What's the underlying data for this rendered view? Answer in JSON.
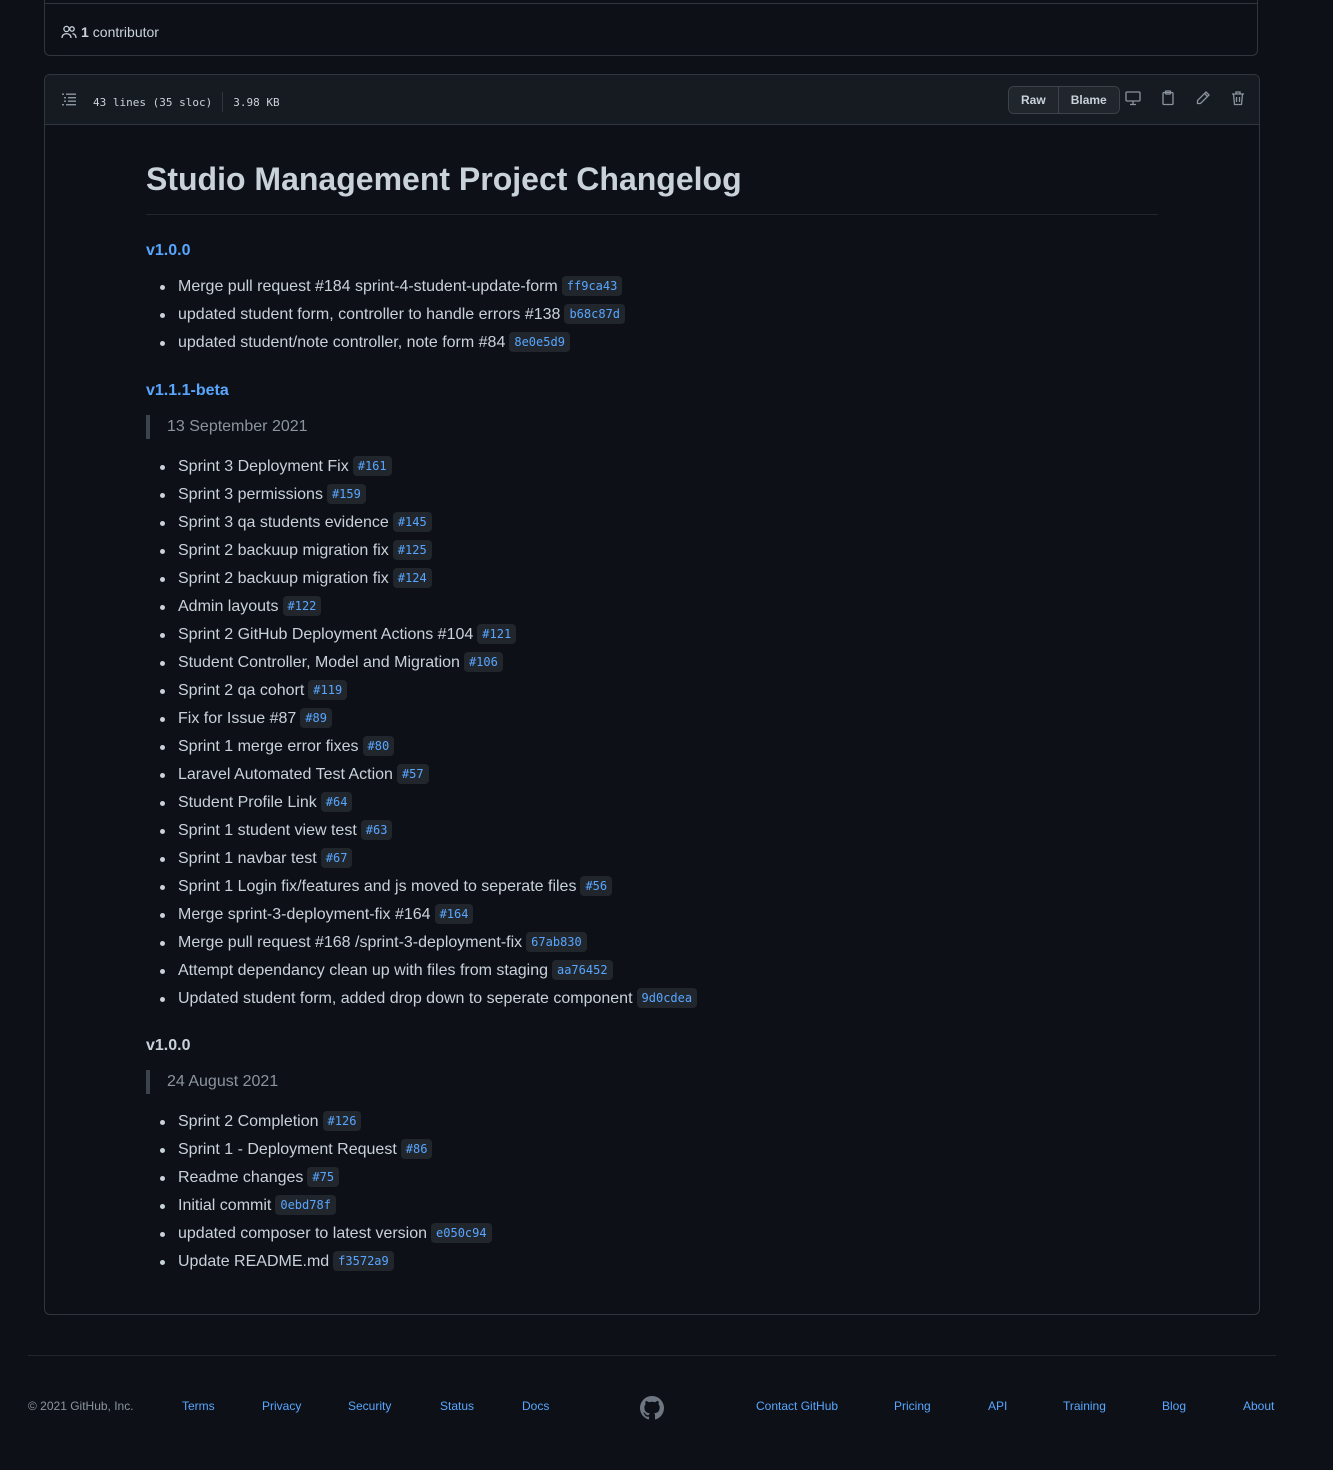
{
  "contributors": {
    "count": "1",
    "label": "contributor"
  },
  "file_header": {
    "lines": "43 lines (35 sloc)",
    "size": "3.98 KB",
    "raw_label": "Raw",
    "blame_label": "Blame"
  },
  "icons": [
    "toc-icon",
    "desktop-icon",
    "clipboard-icon",
    "pencil-icon",
    "trash-icon",
    "people-icon",
    "github-mark-icon"
  ],
  "markdown": {
    "title": "Studio Management Project Changelog",
    "section1": {
      "heading": "v1.0.0",
      "items": [
        {
          "text": "Merge pull request #184 sprint-4-student-update-form",
          "code": "ff9ca43"
        },
        {
          "text": "updated student form, controller to handle errors #138",
          "code": "b68c87d"
        },
        {
          "text": "updated student/note controller, note form #84",
          "code": "8e0e5d9"
        }
      ]
    },
    "section2": {
      "heading": "v1.1.1-beta",
      "date": "13 September 2021",
      "items": [
        {
          "text": "Sprint 3 Deployment Fix",
          "code": "#161"
        },
        {
          "text": "Sprint 3 permissions",
          "code": "#159"
        },
        {
          "text": "Sprint 3 qa students evidence",
          "code": "#145"
        },
        {
          "text": "Sprint 2 backuup migration fix",
          "code": "#125"
        },
        {
          "text": "Sprint 2 backuup migration fix",
          "code": "#124"
        },
        {
          "text": "Admin layouts",
          "code": "#122"
        },
        {
          "text": "Sprint 2 GitHub Deployment Actions #104",
          "code": "#121"
        },
        {
          "text": "Student Controller, Model and Migration",
          "code": "#106"
        },
        {
          "text": "Sprint 2 qa cohort",
          "code": "#119"
        },
        {
          "text": "Fix for Issue #87",
          "code": "#89"
        },
        {
          "text": "Sprint 1 merge error fixes",
          "code": "#80"
        },
        {
          "text": "Laravel Automated Test Action",
          "code": "#57"
        },
        {
          "text": "Student Profile Link",
          "code": "#64"
        },
        {
          "text": "Sprint 1 student view test",
          "code": "#63"
        },
        {
          "text": "Sprint 1 navbar test",
          "code": "#67"
        },
        {
          "text": "Sprint 1 Login fix/features and js moved to seperate files",
          "code": "#56"
        },
        {
          "text": "Merge sprint-3-deployment-fix #164",
          "code": "#164"
        },
        {
          "text": "Merge pull request #168 /sprint-3-deployment-fix",
          "code": "67ab830"
        },
        {
          "text": "Attempt dependancy clean up with files from staging",
          "code": "aa76452"
        },
        {
          "text": "Updated student form, added drop down to seperate component",
          "code": "9d0cdea"
        }
      ]
    },
    "section3": {
      "heading": "v1.0.0",
      "date": "24 August 2021",
      "items": [
        {
          "text": "Sprint 2 Completion",
          "code": "#126"
        },
        {
          "text": "Sprint 1 - Deployment Request",
          "code": "#86"
        },
        {
          "text": "Readme changes",
          "code": "#75"
        },
        {
          "text": "Initial commit",
          "code": "0ebd78f"
        },
        {
          "text": "updated composer to latest version",
          "code": "e050c94"
        },
        {
          "text": "Update README.md",
          "code": "f3572a9"
        }
      ]
    }
  },
  "footer": {
    "copyright": "© 2021 GitHub, Inc.",
    "links": [
      "Terms",
      "Privacy",
      "Security",
      "Status",
      "Docs",
      "Contact GitHub",
      "Pricing",
      "API",
      "Training",
      "Blog",
      "About"
    ]
  },
  "colors": {
    "background": "#0d1117",
    "link": "#58a6ff",
    "text": "#c9d1d9",
    "border": "#30363d"
  }
}
